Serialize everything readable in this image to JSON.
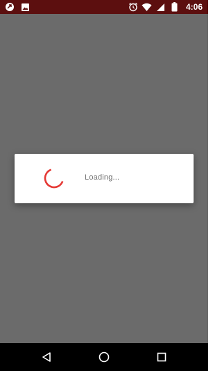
{
  "status_bar": {
    "time": "4:06",
    "left_icons": [
      "sync-icon",
      "image-icon"
    ],
    "right_icons": [
      "alarm-icon",
      "wifi-icon",
      "cellular-icon",
      "battery-icon"
    ],
    "background": "#5c0f0f"
  },
  "dialog": {
    "message": "Loading...",
    "spinner_color": "#e53935"
  },
  "navigation_bar": {
    "buttons": [
      "back-icon",
      "home-icon",
      "recents-icon"
    ]
  }
}
